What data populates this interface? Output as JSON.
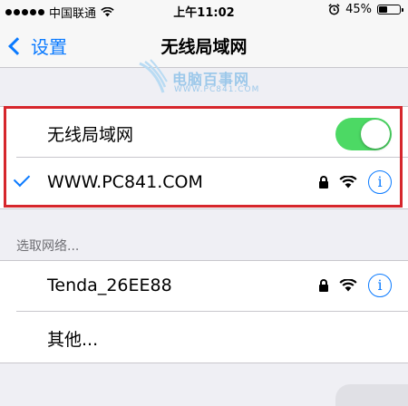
{
  "status_bar": {
    "carrier": "中国联通",
    "time": "上午11:02",
    "battery": "45%",
    "battery_level": 0.45
  },
  "nav": {
    "back_label": "设置",
    "title": "无线局域网"
  },
  "watermark": {
    "name": "电脑百事网",
    "url": "WWW.PC841.COM"
  },
  "wifi_group": {
    "toggle_label": "无线局域网",
    "toggle_on": true,
    "connected_network": "WWW.PC841.COM"
  },
  "choose_header": "选取网络...",
  "networks": [
    {
      "name": "Tenda_26EE88"
    },
    {
      "name": "其他..."
    }
  ],
  "colors": {
    "accent": "#0a7aff",
    "toggle_on": "#4cd964",
    "highlight_box": "#d6262c"
  }
}
